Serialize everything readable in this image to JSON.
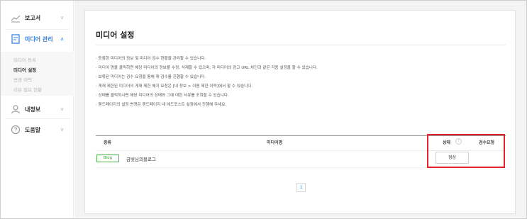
{
  "sidebar": {
    "items": [
      {
        "label": "보고서",
        "icon": "chart-line-icon",
        "active": false
      },
      {
        "label": "미디어 관리",
        "icon": "document-icon",
        "active": true
      },
      {
        "label": "내정보",
        "icon": "person-icon",
        "active": false
      },
      {
        "label": "도움말",
        "icon": "help-circle-icon",
        "active": false
      }
    ],
    "sub_items": [
      "미디어 등록",
      "미디어 설정",
      "변경 이력",
      "리뷰 필요 현황"
    ]
  },
  "page": {
    "title": "미디어 설정",
    "notices": [
      "· 등록한 미디어의 정보 및 미디어 검수 현황을 관리할 수 있습니다.",
      "· 미디어 명을 클릭하면 해당 미디어의 정보를 수정, 삭제할 수 있으며, 각 미디어의 광고 URL 차단과 같은 각종 설정을 할 수 있습니다.",
      "· 보류된 미디어는 검수 요청을 통해 재 검수를 진행할 수 있습니다.",
      "· 게재 제한된 미디어의 게재 제한 해지 요청은 [내 정보 > 이용 제한 이력]에서 할 수 있습니다.",
      "· 상태를 클릭하시면 해당 미디어의 상태와 그에 대한 사유를 조회할 수 있습니다.",
      "· 랜드페이지의 설정 변경은 랜드페이지 내 에드포스트 설정에서 진행해 주세요."
    ],
    "table": {
      "headers": {
        "type": "종류",
        "media_name": "미디어명",
        "status": "상태",
        "help": "?",
        "review_request": "검수요청"
      },
      "rows": [
        {
          "type": "Blog",
          "media_name": "금빛님의블로그",
          "status": "정상"
        }
      ]
    },
    "pagination": {
      "current": "1"
    }
  },
  "colors": {
    "accent": "#2d7be5",
    "highlight": "#e0242a",
    "blog_badge": "#4db34d"
  }
}
